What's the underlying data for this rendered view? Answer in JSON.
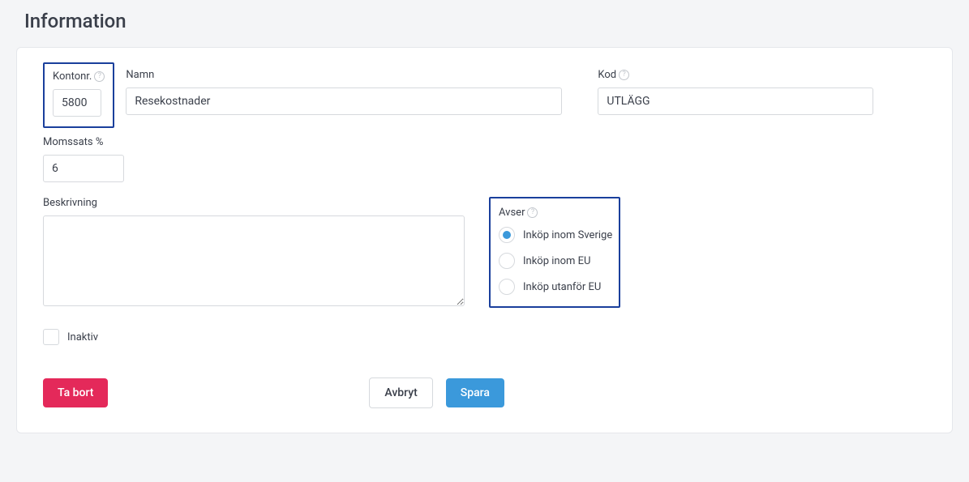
{
  "page": {
    "title": "Information"
  },
  "fields": {
    "kontonr": {
      "label": "Kontonr.",
      "value": "5800"
    },
    "namn": {
      "label": "Namn",
      "value": "Resekostnader"
    },
    "kod": {
      "label": "Kod",
      "value": "UTLÄGG"
    },
    "momssats": {
      "label": "Momssats %",
      "value": "6"
    },
    "beskrivning": {
      "label": "Beskrivning",
      "value": ""
    },
    "avser": {
      "label": "Avser",
      "options": [
        {
          "label": "Inköp inom Sverige",
          "selected": true
        },
        {
          "label": "Inköp inom EU",
          "selected": false
        },
        {
          "label": "Inköp utanför EU",
          "selected": false
        }
      ]
    },
    "inaktiv": {
      "label": "Inaktiv",
      "checked": false
    }
  },
  "buttons": {
    "delete": "Ta bort",
    "cancel": "Avbryt",
    "save": "Spara"
  }
}
